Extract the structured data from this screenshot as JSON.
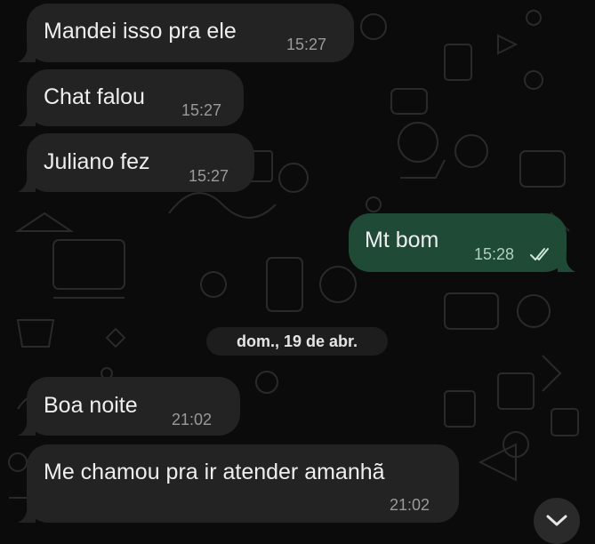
{
  "theme": {
    "incoming_bubble_color": "#232323",
    "outgoing_bubble_color": "#1f4a36",
    "read_ticks_color": "#cfe7da"
  },
  "messages": [
    {
      "direction": "incoming",
      "text": "Mandei isso pra ele",
      "time": "15:27"
    },
    {
      "direction": "incoming",
      "text": "Chat falou",
      "time": "15:27"
    },
    {
      "direction": "incoming",
      "text": "Juliano fez",
      "time": "15:27"
    },
    {
      "direction": "outgoing",
      "text": "Mt bom",
      "time": "15:28",
      "status_icon": "double-check-icon"
    },
    {
      "direction": "incoming",
      "text": "Boa noite",
      "time": "21:02"
    },
    {
      "direction": "incoming",
      "text": "Me chamou pra ir atender amanhã",
      "time": "21:02"
    }
  ],
  "date_separator": "dom., 19 de abr.",
  "scroll_button": {
    "icon": "chevron-down-icon"
  }
}
